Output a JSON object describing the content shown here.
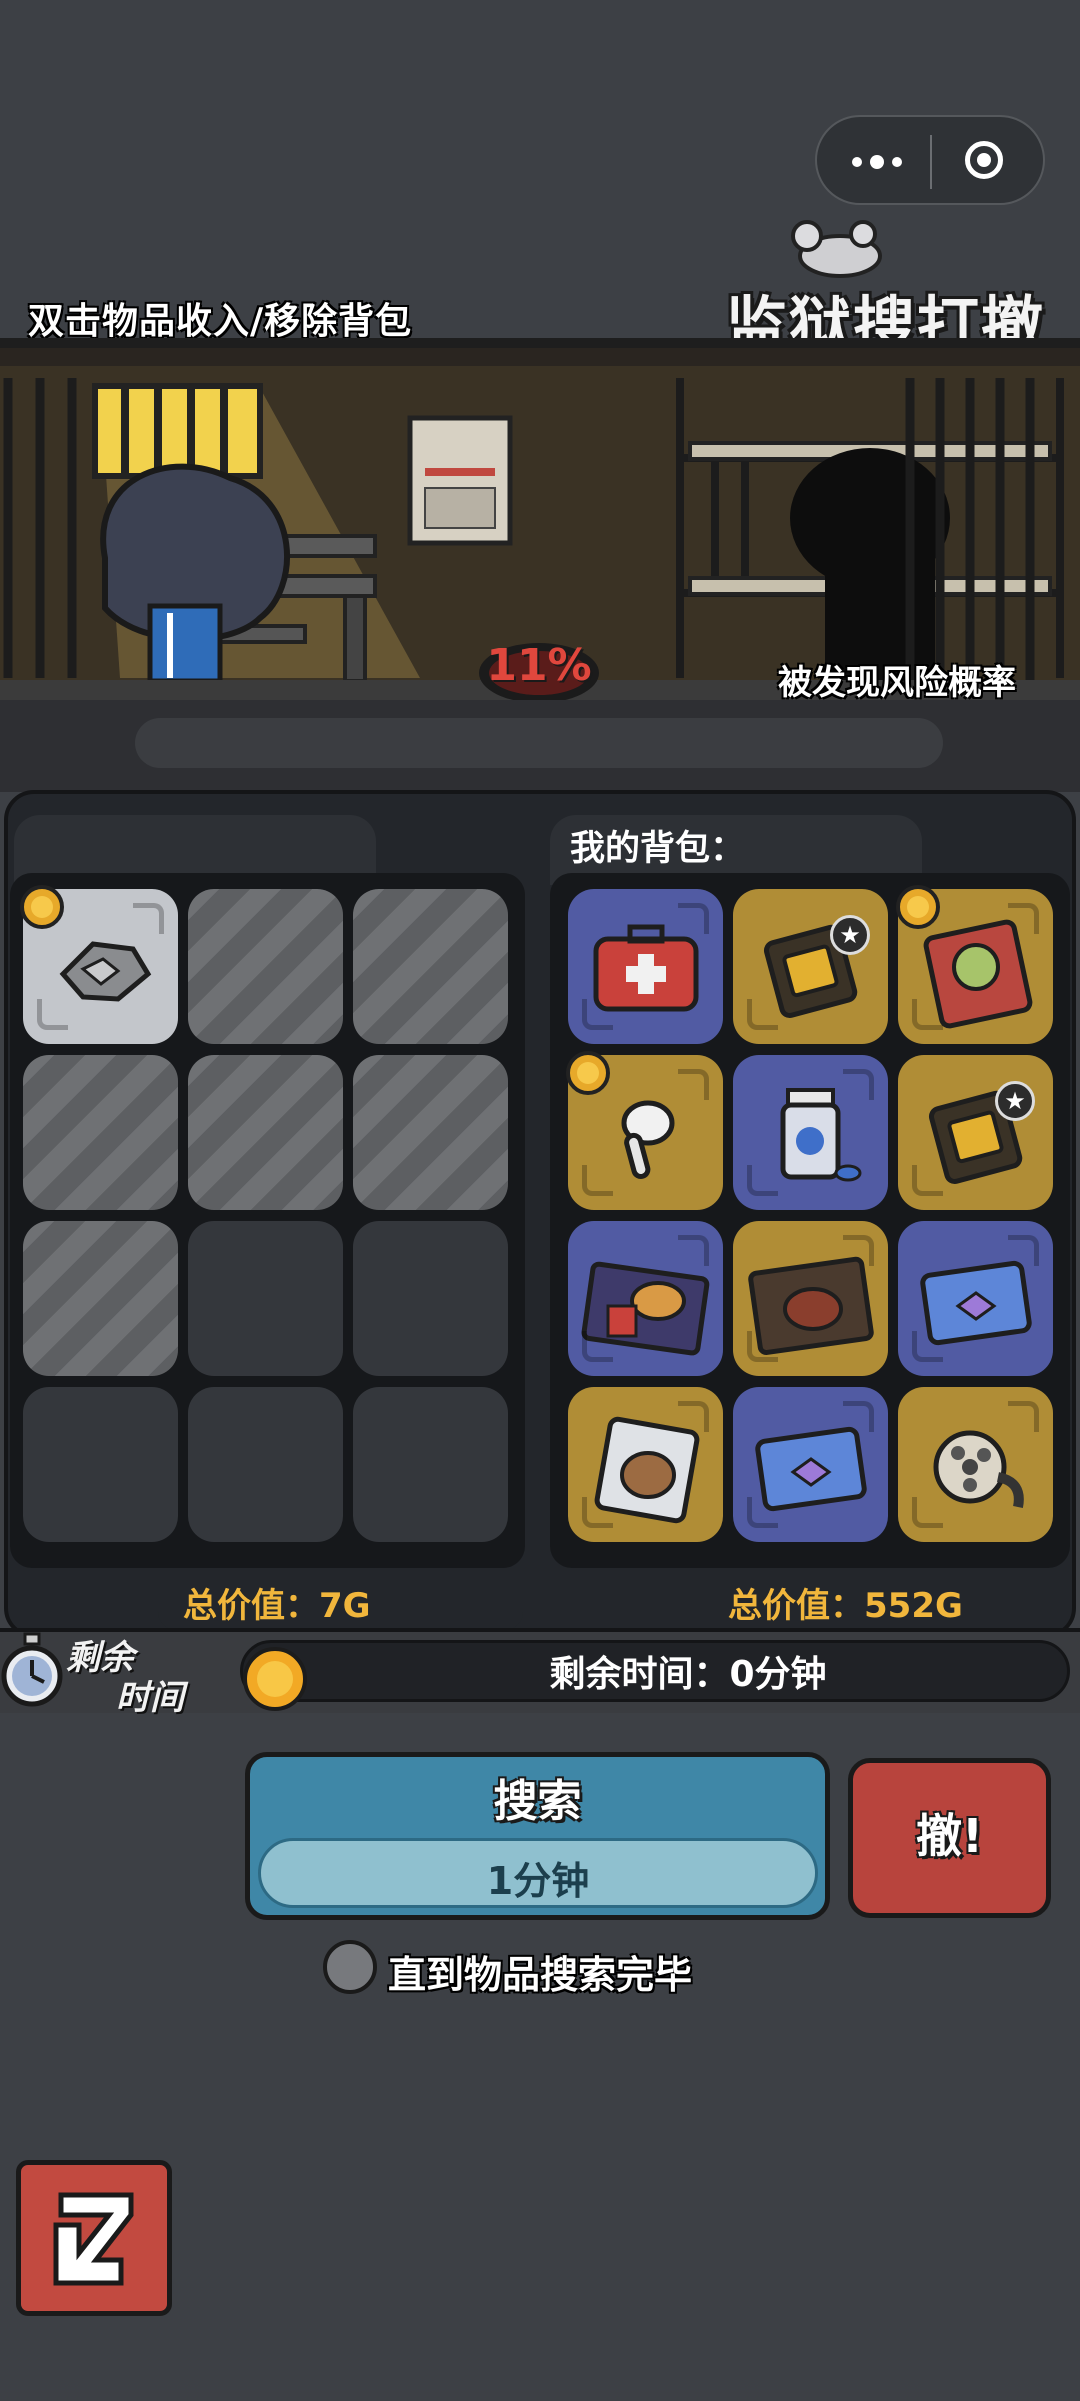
{
  "header": {
    "hint": "双击物品收入/移除背包",
    "logo": "监狱搜打撤"
  },
  "scene": {
    "risk_percent": "11%",
    "risk_label": "被发现风险概率"
  },
  "search_area": {
    "slots": [
      {
        "state": "item",
        "item": "broken-plate",
        "coin": true
      },
      {
        "state": "locked"
      },
      {
        "state": "locked"
      },
      {
        "state": "locked"
      },
      {
        "state": "locked"
      },
      {
        "state": "locked"
      },
      {
        "state": "locked"
      },
      {
        "state": "empty"
      },
      {
        "state": "empty"
      },
      {
        "state": "empty"
      },
      {
        "state": "empty"
      },
      {
        "state": "empty"
      }
    ],
    "total_value": "总价值：7G"
  },
  "backpack": {
    "title": "我的背包：",
    "items": [
      {
        "name": "first-aid-kit",
        "bg": "blue"
      },
      {
        "name": "gold-card",
        "bg": "gold",
        "star": true
      },
      {
        "name": "apple-time-book",
        "bg": "gold",
        "coin": true
      },
      {
        "name": "earbud",
        "bg": "gold",
        "coin": true
      },
      {
        "name": "pill-bottle",
        "bg": "blue"
      },
      {
        "name": "gold-card",
        "bg": "gold",
        "star": true
      },
      {
        "name": "burger-snack",
        "bg": "blue"
      },
      {
        "name": "steak-pack",
        "bg": "gold"
      },
      {
        "name": "ticket",
        "bg": "blue"
      },
      {
        "name": "capybara-pack",
        "bg": "gold"
      },
      {
        "name": "ticket",
        "bg": "blue"
      },
      {
        "name": "film-reel",
        "bg": "gold"
      }
    ],
    "total_value": "总价值：552G"
  },
  "timer": {
    "label_line1": "剩余",
    "label_line2": "时间",
    "text": "剩余时间：0分钟"
  },
  "actions": {
    "search_label": "搜索",
    "search_time": "1分钟",
    "extract_label": "撤!",
    "until_done_label": "直到物品搜索完毕"
  },
  "colors": {
    "gold_slot": "#b08d36",
    "blue_slot": "#515ba3",
    "value_text": "#f1b63c",
    "search_button": "#3f87a7",
    "extract_button": "#b8443d"
  }
}
